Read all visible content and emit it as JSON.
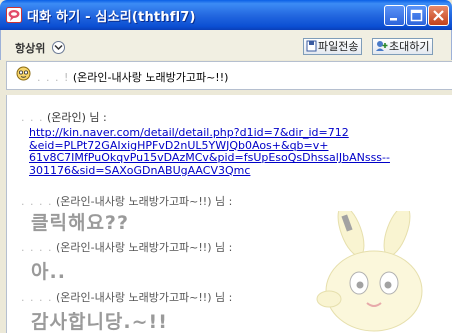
{
  "window": {
    "title": "대화 하기 - 심소리(ththfl7)"
  },
  "toolbar": {
    "always_on_top_label": "항상위",
    "file_send_label": "파일전송",
    "invite_label": "초대하기"
  },
  "header": {
    "text": "(온라인-내사랑 노래방가고파~!!)",
    "prefix_hidden": ". .  . !"
  },
  "messages": [
    {
      "sender_hidden": ".    .  .",
      "status": "(온라인) 님 :",
      "link_lines": [
        "http://kin.naver.com/detail/detail.php?d1id=7&dir_id=712",
        "&eid=PLPt72GAIxigHPFvD2nUL5YWJQb0Aos+&qb=v+",
        "61v8C7IMfPuOkqvPu15vDAzMCv&pid=fsUpEsoQsDhssalJbANsss--",
        "301176&sid=SAXoGDnABUgAACV3Qmc"
      ]
    },
    {
      "sender_hidden": "  .  . . .",
      "status": "(온라인-내사랑 노래방가고파~!!) 님 :",
      "text": "클릭해요??"
    },
    {
      "sender_hidden": "  . .  .  .",
      "status": "(온라인-내사랑 노래방가고파~!!) 님 :",
      "text": "아.."
    },
    {
      "sender_hidden": ". . . .",
      "status": "(온라인-내사랑 노래방가고파~!!) 님 :",
      "text": "감사합니당.~!!"
    }
  ],
  "colors": {
    "titlebar": "#2468E0",
    "link": "#0000C8",
    "chat_background": "#FFFFFF"
  }
}
